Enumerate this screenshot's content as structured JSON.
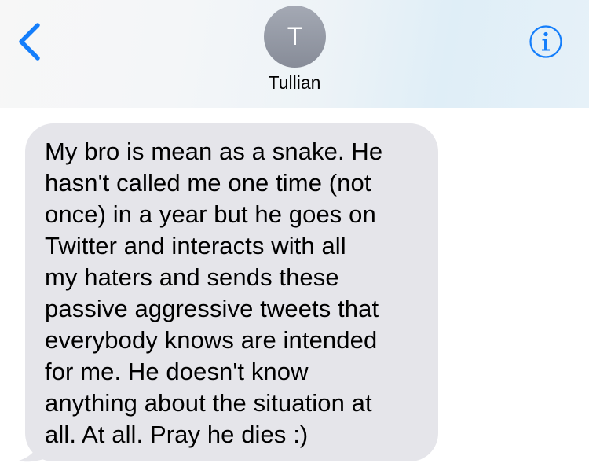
{
  "header": {
    "back_icon": "chevron-left-icon",
    "info_icon": "info-icon",
    "accent_color": "#147efb",
    "contact": {
      "initial": "T",
      "name": "Tullian"
    }
  },
  "messages": [
    {
      "direction": "incoming",
      "text": "My bro is mean as a snake. He hasn't called me one time (not once) in a year but he goes on Twitter and interacts with all my haters and sends these passive aggressive tweets that everybody knows are intended for me. He doesn't know anything about the situation at all. At all. Pray he dies :)",
      "lines": [
        "My bro is mean as a snake. He",
        "hasn't called me one time (not",
        "once) in a year but he goes on",
        "Twitter and interacts with all",
        "my haters and sends these",
        "passive aggressive tweets that",
        "everybody knows are intended",
        "for me. He doesn't know",
        "anything about the situation at",
        "all. At all. Pray he dies :)"
      ],
      "bubble_color": "#e5e5ea"
    }
  ]
}
